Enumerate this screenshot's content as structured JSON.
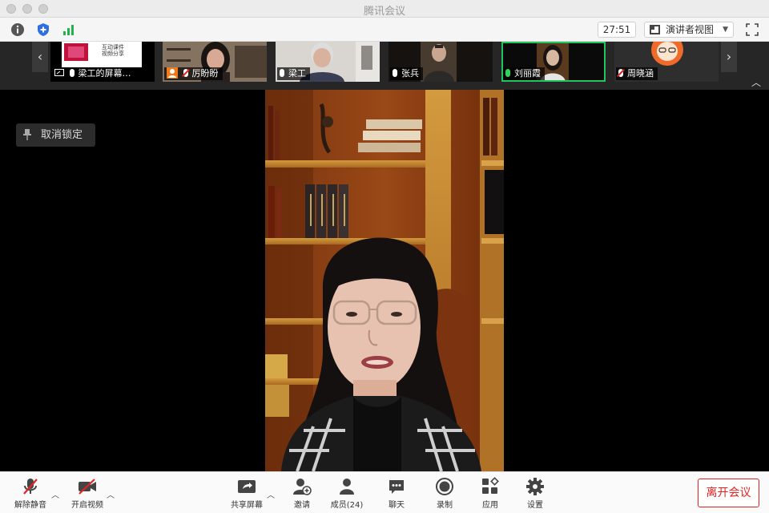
{
  "window": {
    "title": "腾讯会议"
  },
  "toolbar": {
    "timer": "27:51",
    "view_mode": "演讲者视图"
  },
  "participants": [
    {
      "name": "梁工的屏幕…",
      "mic": "on"
    },
    {
      "name": "厉盼盼",
      "mic": "muted"
    },
    {
      "name": "梁工",
      "mic": "on"
    },
    {
      "name": "张兵",
      "mic": "on"
    },
    {
      "name": "刘丽霞",
      "mic": "speaking"
    },
    {
      "name": "周晓涵",
      "mic": "muted"
    }
  ],
  "thumb_screen_text": "互动课件\n视频分享",
  "stage": {
    "unpin_label": "取消锁定"
  },
  "controls": {
    "unmute": "解除静音",
    "start_video": "开启视频",
    "share_screen": "共享屏幕",
    "invite": "邀请",
    "members": "成员(24)",
    "chat": "聊天",
    "record": "录制",
    "apps": "应用",
    "settings": "设置",
    "leave": "离开会议"
  },
  "colors": {
    "active_speaker": "#21c45d",
    "leave_red": "#e02424",
    "muted_red": "#e02424"
  }
}
